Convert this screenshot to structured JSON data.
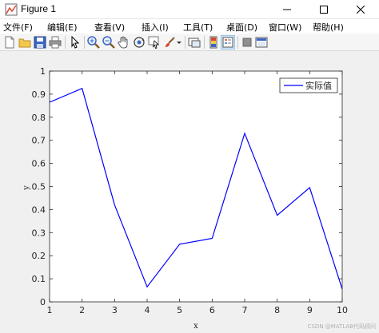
{
  "window": {
    "title": "Figure 1"
  },
  "menu": {
    "items": [
      "文件(F)",
      "编辑(E)",
      "查看(V)",
      "插入(I)",
      "工具(T)",
      "桌面(D)",
      "窗口(W)",
      "帮助(H)"
    ]
  },
  "toolbar": {
    "icons": [
      "new-figure-icon",
      "open-file-icon",
      "save-icon",
      "print-icon",
      "select-arrow-icon",
      "zoom-in-icon",
      "zoom-out-icon",
      "pan-hand-icon",
      "rotate-3d-icon",
      "data-cursor-icon",
      "brush-icon",
      "brush-dropdown-icon",
      "link-plot-icon",
      "colorbar-icon",
      "legend-icon",
      "hide-plot-tools-icon",
      "show-plot-tools-icon"
    ]
  },
  "watermark": "CSDN @MATLAB代码顾问",
  "chart_data": {
    "type": "line",
    "title": "",
    "xlabel": "x",
    "ylabel": "y",
    "xlim": [
      1,
      10
    ],
    "ylim": [
      0,
      1
    ],
    "x_ticks": [
      "1",
      "2",
      "3",
      "4",
      "5",
      "6",
      "7",
      "8",
      "9",
      "10"
    ],
    "y_ticks": [
      "0",
      "0.1",
      "0.2",
      "0.3",
      "0.4",
      "0.5",
      "0.6",
      "0.7",
      "0.8",
      "0.9",
      "1"
    ],
    "grid": false,
    "legend_position": "top-right",
    "series": [
      {
        "name": "实际值",
        "color": "#0000ff",
        "x": [
          1,
          2,
          3,
          4,
          5,
          6,
          7,
          8,
          9,
          10
        ],
        "values": [
          0.865,
          0.925,
          0.42,
          0.065,
          0.25,
          0.275,
          0.73,
          0.375,
          0.495,
          0.055
        ]
      }
    ]
  }
}
